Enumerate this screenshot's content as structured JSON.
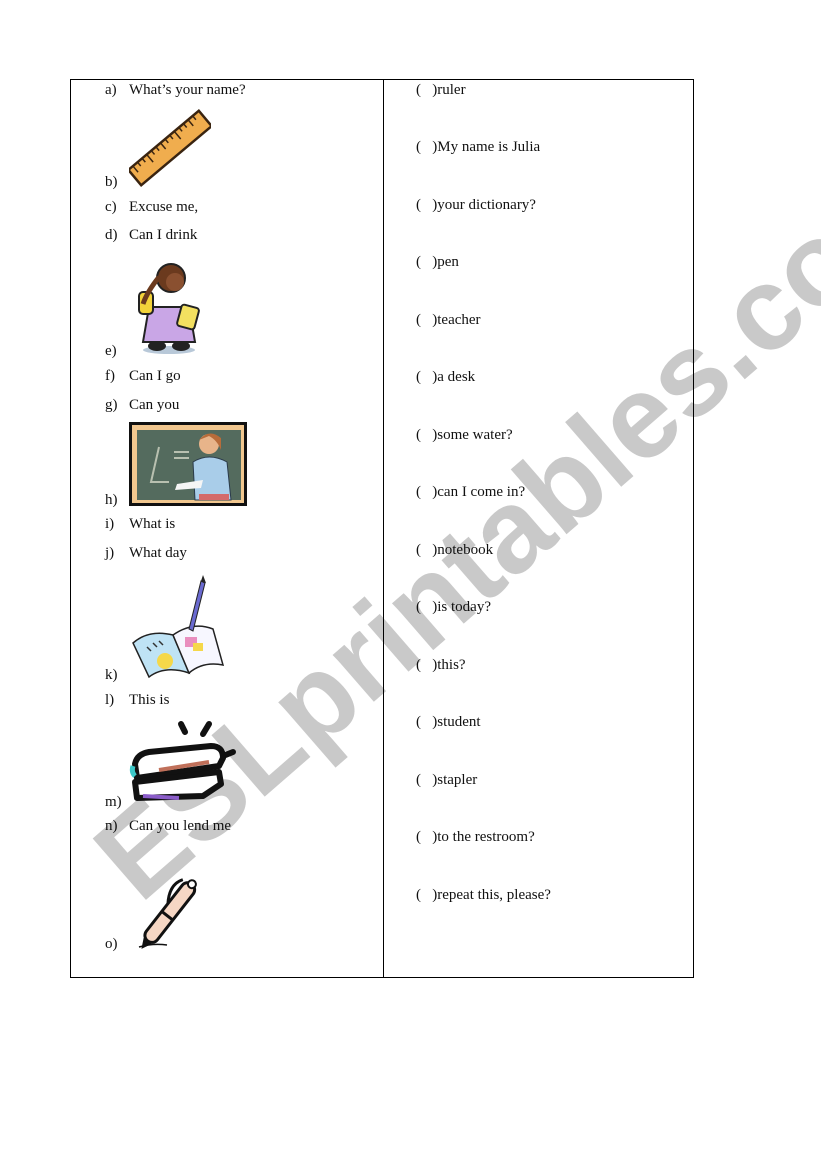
{
  "watermark": {
    "text": "ESLprintables.com",
    "color": "#c4c4c4"
  },
  "left_column": {
    "items": [
      {
        "label": "a)",
        "text": "What’s your name?"
      },
      {
        "label": "b)",
        "text": "",
        "icon": "ruler-picture"
      },
      {
        "label": "c)",
        "text": "Excuse me,"
      },
      {
        "label": "d)",
        "text": "Can I drink"
      },
      {
        "label": "e)",
        "text": "",
        "icon": "student-girl-picture"
      },
      {
        "label": "f)",
        "text": "Can I go"
      },
      {
        "label": "g)",
        "text": "Can you"
      },
      {
        "label": "h)",
        "text": "",
        "icon": "teacher-at-blackboard-picture"
      },
      {
        "label": "i)",
        "text": "What is"
      },
      {
        "label": "j)",
        "text": "What day"
      },
      {
        "label": "k)",
        "text": "",
        "icon": "notebook-picture"
      },
      {
        "label": "l)",
        "text": "This is"
      },
      {
        "label": "m)",
        "text": "",
        "icon": "stapler-picture"
      },
      {
        "label": "n)",
        "text": "Can you lend me"
      },
      {
        "label": "o)",
        "text": "",
        "icon": "pen-picture"
      }
    ]
  },
  "right_column": {
    "blank": "(   )",
    "items": [
      "ruler",
      "My name is Julia",
      "your dictionary?",
      "pen",
      "teacher",
      "a desk",
      "some water?",
      "can I come in?",
      "notebook",
      "is today?",
      "this?",
      "student",
      "stapler",
      "to the restroom?",
      "repeat this, please?"
    ]
  }
}
